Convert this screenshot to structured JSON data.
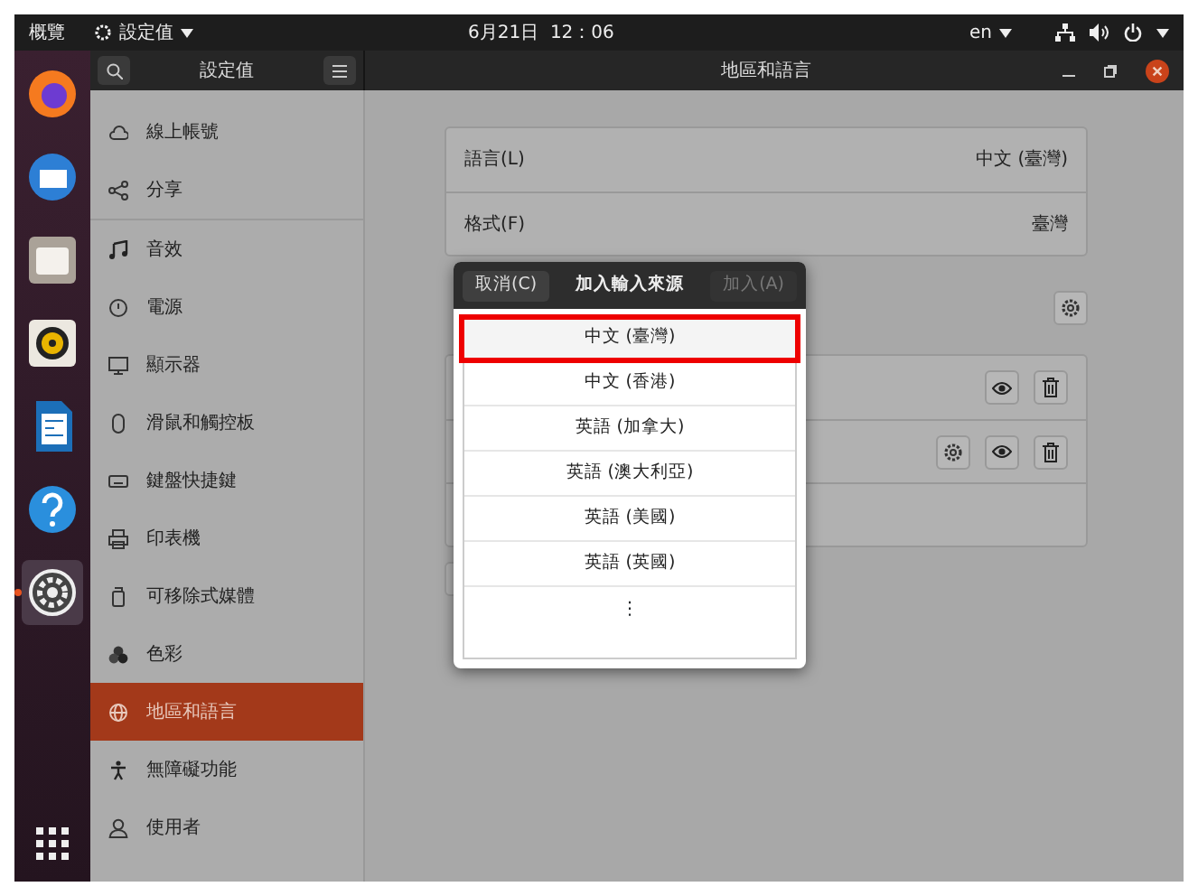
{
  "top_bar": {
    "activities": "概覽",
    "app_menu": "設定值",
    "clock": "6月21日  12：06",
    "keyboard": "en"
  },
  "dock": {
    "apps": [
      {
        "kind": "browser",
        "running": false
      },
      {
        "kind": "mail",
        "running": false
      },
      {
        "kind": "files",
        "running": false
      },
      {
        "kind": "music",
        "running": false
      },
      {
        "kind": "writer",
        "running": false
      },
      {
        "kind": "help",
        "running": false
      },
      {
        "kind": "settings",
        "running": true
      }
    ]
  },
  "header": {
    "sidebar_title": "設定值",
    "title": "地區和語言"
  },
  "sidebar": {
    "groups": [
      [
        {
          "kind": "cloud",
          "label": "線上帳號",
          "selected": false
        },
        {
          "kind": "share",
          "label": "分享",
          "selected": false
        }
      ],
      [
        {
          "kind": "note",
          "label": "音效",
          "selected": false
        },
        {
          "kind": "power",
          "label": "電源",
          "selected": false
        },
        {
          "kind": "display",
          "label": "顯示器",
          "selected": false
        },
        {
          "kind": "mouse",
          "label": "滑鼠和觸控板",
          "selected": false
        },
        {
          "kind": "keyboard",
          "label": "鍵盤快捷鍵",
          "selected": false
        },
        {
          "kind": "printer",
          "label": "印表機",
          "selected": false
        },
        {
          "kind": "drive",
          "label": "可移除式媒體",
          "selected": false
        },
        {
          "kind": "color",
          "label": "色彩",
          "selected": false
        },
        {
          "kind": "globe",
          "label": "地區和語言",
          "selected": true
        },
        {
          "kind": "person",
          "label": "無障礙功能",
          "selected": false
        },
        {
          "kind": "user",
          "label": "使用者",
          "selected": false
        }
      ]
    ]
  },
  "content": {
    "rows": [
      {
        "label": "語言(L)",
        "value": "中文 (臺灣)"
      },
      {
        "label": "格式(F)",
        "value": "臺灣"
      }
    ],
    "input_sources": [
      {
        "has_settings": false
      },
      {
        "has_settings": true
      }
    ]
  },
  "dialog": {
    "cancel": "取消(C)",
    "title": "加入輸入來源",
    "add": {
      "label": "加入(A)",
      "disabled": true
    },
    "items": [
      {
        "label": "中文 (臺灣)",
        "selected": true
      },
      {
        "label": "中文 (香港)",
        "selected": false
      },
      {
        "label": "英語 (加拿大)",
        "selected": false
      },
      {
        "label": "英語 (澳大利亞)",
        "selected": false
      },
      {
        "label": "英語 (美國)",
        "selected": false
      },
      {
        "label": "英語 (英國)",
        "selected": false
      }
    ],
    "more": "⋮"
  }
}
